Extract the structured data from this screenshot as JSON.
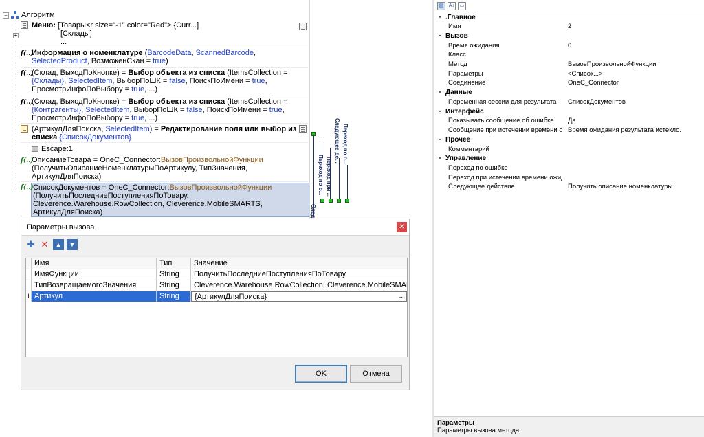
{
  "tree": {
    "root_label": "Алгоритм",
    "menu": {
      "label": "Меню:",
      "line1": "[Товары<r size=\"-1\" color=\"Red\"> {Curr...]",
      "line2": "[Склады]",
      "line3": "..."
    },
    "info": {
      "name": "Информация о номенклатуре",
      "open": "(",
      "arg1": "BarcodeData",
      "sep": ", ",
      "arg2": "ScannedBarcode",
      "arg3": "SelectedProduct",
      "arg4": "ВозможенСкан = ",
      "val": "true",
      "close": ")"
    },
    "select1": {
      "prefix": "(Склад, ВыходПоКнопке) = ",
      "name": "Выбор объекта из списка",
      "rest1": " (ItemsCollection =",
      "coll": "{Склады}",
      "item": "SelectedItem",
      "l2a": ", ВыборПоШК = ",
      "false": "false",
      "l2b": ", ПоискПоИмени = ",
      "true": "true",
      "l3": "ПросмотрИнфоПоВыбору = ",
      "l3end": ", ...)"
    },
    "select2": {
      "prefix": "(Склад, ВыходПоКнопке) = ",
      "name": "Выбор объекта из списка",
      "rest1": " (ItemsCollection =",
      "coll": "{Контрагенты}",
      "item": "SelectedItem"
    },
    "edit": {
      "prefix": "(АртикулДляПоиска, ",
      "item": "SelectedItem",
      "mid": ") = ",
      "name1": "Редактирование поля или выбор из",
      "name2": "списка",
      "coll": "{СписокДокументов}",
      "escape": "Escape:1"
    },
    "call1": {
      "l1a": "ОписаниеТовара = OneC_Connector:",
      "fn": "ВызовПроизвольнойФункции",
      "l2": "(ПолучитьОписаниеНоменклатурыПоАртикулу, ТипЗначения,",
      "l3": "АртикулДляПоиска)"
    },
    "call2": {
      "l1a": "СписокДокументов = OneC_Connector:",
      "fn": "ВызовПроизвольнойФункции",
      "l2": "(ПолучитьПоследниеПоступленияПоТовару,",
      "l3": "Cleverence.Warehouse.RowCollection, Cleverence.MobileSMARTS,",
      "l4": "АртикулДляПоиска)"
    },
    "connectors": {
      "label1": "Переход по о...",
      "label2": "Следующее де...",
      "label3": "Переход при ...",
      "label4": "Переход по о...",
      "label5": "След"
    }
  },
  "dialog": {
    "title": "Параметры вызова",
    "close_glyph": "✕",
    "columns": [
      "Имя",
      "Тип",
      "Значение"
    ],
    "rows": [
      {
        "marker": "",
        "name": "ИмяФункции",
        "type": "String",
        "value": "ПолучитьПоследниеПоступленияПоТовару"
      },
      {
        "marker": "",
        "name": "ТипВозвращаемогоЗначения",
        "type": "String",
        "value": "Cleverence.Warehouse.RowCollection, Cleverence.MobileSMARTS"
      },
      {
        "marker": "I",
        "name": "Артикул",
        "type": "String",
        "value": "{АртикулДляПоиска}",
        "ellipsis": "..."
      }
    ],
    "ok_label": "OK",
    "cancel_label": "Отмена"
  },
  "properties": {
    "categories": [
      {
        "name": "Главное",
        "rows": [
          {
            "name": "Имя",
            "value": "2"
          }
        ]
      },
      {
        "name": "Вызов",
        "rows": [
          {
            "name": "Время ожидания",
            "value": "0"
          },
          {
            "name": "Класс",
            "value": ""
          },
          {
            "name": "Метод",
            "value": "ВызовПроизвольнойФункции"
          },
          {
            "name": "Параметры",
            "value": "<Список...>"
          },
          {
            "name": "Соединение",
            "value": "OneC_Connector"
          }
        ]
      },
      {
        "name": "Данные",
        "rows": [
          {
            "name": "Переменная сессии для результата",
            "value": "СписокДокументов"
          }
        ]
      },
      {
        "name": "Интерфейс",
        "rows": [
          {
            "name": "Показывать сообщение об ошибке",
            "value": "Да"
          },
          {
            "name": "Сообщение при истечении времени ожида",
            "value": "Время ожидания результата истекло."
          }
        ]
      },
      {
        "name": "Прочее",
        "rows": [
          {
            "name": "Комментарий",
            "value": ""
          }
        ]
      },
      {
        "name": "Управление",
        "rows": [
          {
            "name": "Переход по ошибке",
            "value": ""
          },
          {
            "name": "Переход при истечении времени ожидания",
            "value": ""
          },
          {
            "name": "Следующее действие",
            "value": "Получить описание номенклатуры"
          }
        ]
      }
    ],
    "desc_title": "Параметры",
    "desc_text": "Параметры вызова метода."
  }
}
